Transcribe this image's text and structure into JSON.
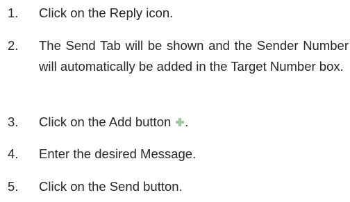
{
  "steps": [
    {
      "number": "1.",
      "text": "Click on the Reply icon."
    },
    {
      "number": "2.",
      "text": "The Send Tab will be shown and the Sender Number will automatically be added in the Target Number box."
    },
    {
      "number": "3.",
      "text": "Click on the Add button",
      "suffix": ".",
      "icon": "add-plus-icon"
    },
    {
      "number": "4.",
      "text": "Enter the desired Message."
    },
    {
      "number": "5.",
      "text": "Click on the Send button."
    }
  ],
  "colors": {
    "text": "#262626",
    "icon_plus": "#9bc89b"
  }
}
